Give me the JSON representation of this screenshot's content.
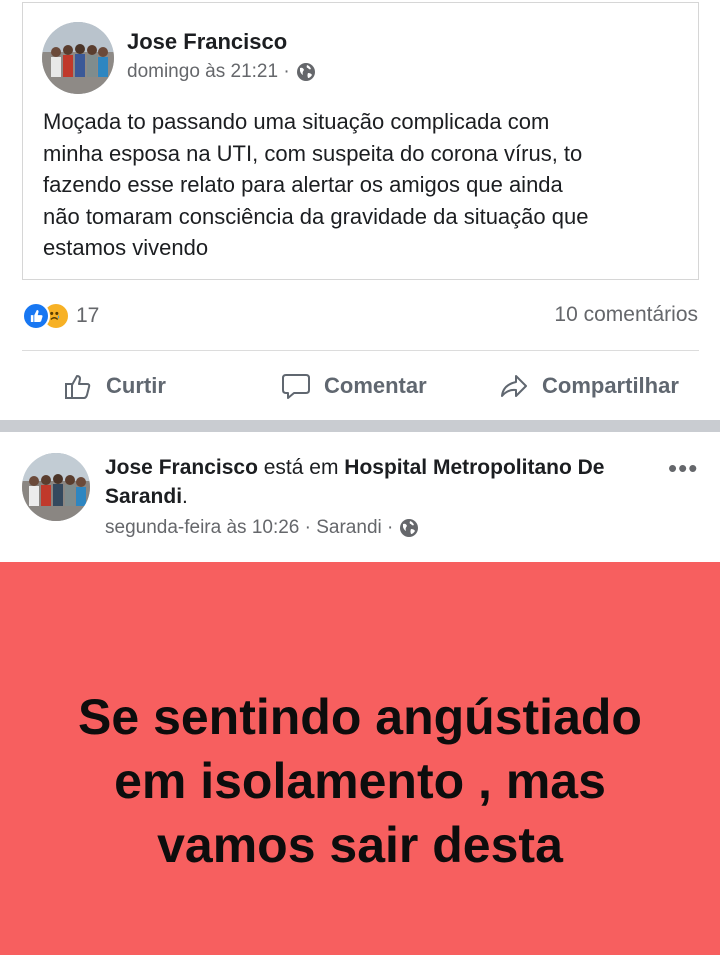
{
  "post1": {
    "author": "Jose Francisco",
    "timestamp": "domingo às 21:21 ·",
    "privacy_icon": "globe-icon",
    "text": "Moçada to passando uma situação complicada com\nminha esposa na UTI,  com suspeita do corona vírus,  to\nfazendo esse relato para alertar os amigos que ainda\nnão tomaram consciência da gravidade da situação que\nestamos vivendo"
  },
  "reactions": {
    "icons": [
      "like-icon",
      "sad-icon"
    ],
    "count": "17",
    "comments": "10 comentários"
  },
  "actions": {
    "like_label": "Curtir",
    "comment_label": "Comentar",
    "share_label": "Compartilhar"
  },
  "post2": {
    "author": "Jose Francisco",
    "connector": " está em ",
    "place": "Hospital Metropolitano De Sarandi",
    "period": ".",
    "timestamp": "segunda-feira às 10:26 · Sarandi ·",
    "privacy_icon": "globe-icon",
    "banner_text": "Se sentindo angústiado\nem isolamento , mas\nvamos sair desta",
    "banner_color": "#f75f5f"
  },
  "colors": {
    "like_blue": "#1877f2",
    "secondary_text": "#65676b",
    "separator": "#c9ccd1"
  }
}
